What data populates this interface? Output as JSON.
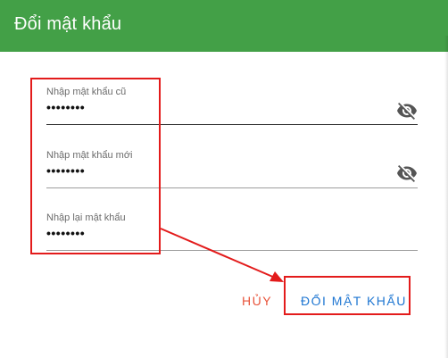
{
  "dialog": {
    "title": "Đổi mật khẩu",
    "fields": [
      {
        "label": "Nhập mật khẩu cũ",
        "value": "••••••••",
        "has_visibility_toggle": true,
        "icon": "eye-off-icon"
      },
      {
        "label": "Nhập mật khẩu mới",
        "value": "••••••••",
        "has_visibility_toggle": true,
        "icon": "eye-off-icon"
      },
      {
        "label": "Nhập lại mật khẩu",
        "value": "••••••••",
        "has_visibility_toggle": false
      }
    ],
    "actions": {
      "cancel_label": "HỦY",
      "submit_label": "ĐỔI MẬT KHẨU"
    }
  },
  "colors": {
    "header": "#43a047",
    "annotation": "#e31b1b",
    "cancel": "#e8533a",
    "submit": "#1e76d2"
  }
}
